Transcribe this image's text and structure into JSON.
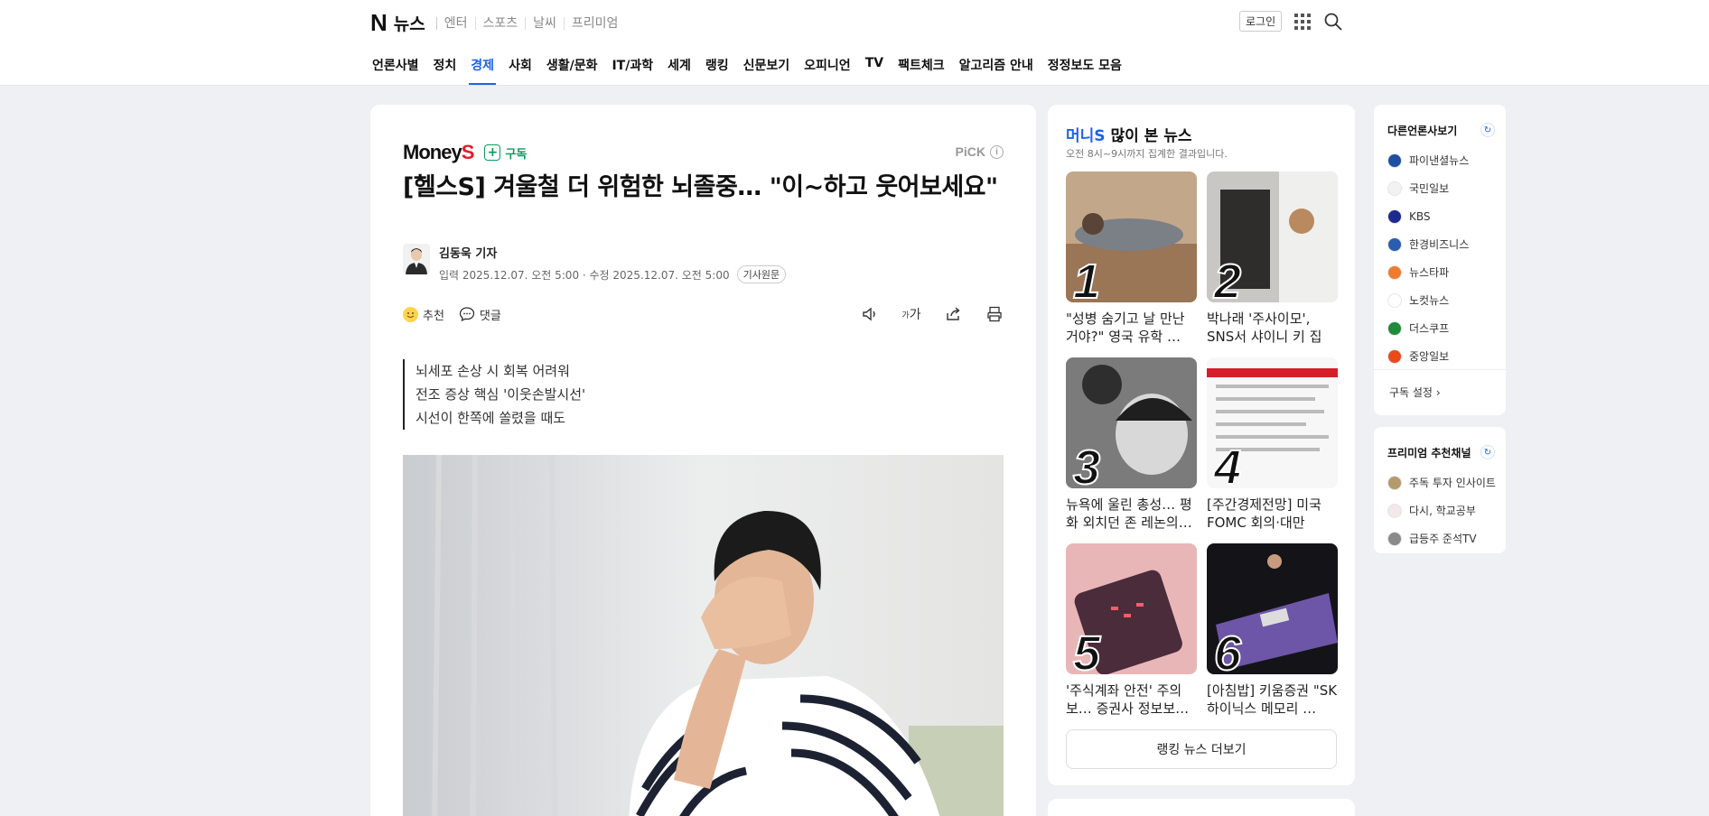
{
  "header": {
    "logo": "N",
    "site_name": "뉴스",
    "services": [
      "엔터",
      "스포츠",
      "날씨",
      "프리미엄"
    ],
    "login_label": "로그인"
  },
  "categories": [
    {
      "label": "언론사별",
      "active": false
    },
    {
      "label": "정치",
      "active": false
    },
    {
      "label": "경제",
      "active": true
    },
    {
      "label": "사회",
      "active": false
    },
    {
      "label": "생활/문화",
      "active": false
    },
    {
      "label": "IT/과학",
      "active": false
    },
    {
      "label": "세계",
      "active": false
    },
    {
      "label": "랭킹",
      "active": false
    },
    {
      "label": "신문보기",
      "active": false
    },
    {
      "label": "오피니언",
      "active": false
    },
    {
      "label": "TV",
      "active": false
    },
    {
      "label": "팩트체크",
      "active": false
    },
    {
      "label": "알고리즘 안내",
      "active": false
    },
    {
      "label": "정정보도 모음",
      "active": false
    }
  ],
  "article": {
    "press_name": "Money",
    "press_name_accent": "S",
    "subscribe_label": "구독",
    "pick_label": "PiCK",
    "pick_info": "i",
    "headline": "[헬스S] 겨울철 더 위험한 뇌졸중… \"이~하고 웃어보세요\"",
    "reporter": "김동욱 기자",
    "dates": "입력 2025.12.07. 오전 5:00 · 수정 2025.12.07. 오전 5:00",
    "original_label": "기사원문",
    "actions": {
      "recommend": "추천",
      "comment": "댓글",
      "font_size": "가"
    },
    "summary": [
      "뇌세포 손상 시 회복 어려워",
      "전조 증상 핵심 '이웃손발시선'",
      "시선이 한쪽에 쏠렸을 때도"
    ]
  },
  "ranking": {
    "press": "머니S",
    "title_rest": "많이 본 뉴스",
    "subtitle": "오전 8시~9시까지 집계한 결과입니다.",
    "items": [
      {
        "rank": "1",
        "title": "\"성병 숨기고 날 만난 거야?\" 영국 유학 …"
      },
      {
        "rank": "2",
        "title": "박나래 '주사이모', SNS서 샤이니 키 집 영…"
      },
      {
        "rank": "3",
        "title": "뉴욕에 울린 총성… 평화 외치던 존 레논의…"
      },
      {
        "rank": "4",
        "title": "[주간경제전망] 미국 FOMC 회의·대만 TS…"
      },
      {
        "rank": "5",
        "title": "'주식계좌 안전' 주의보… 증권사 정보보…"
      },
      {
        "rank": "6",
        "title": "[아침밥] 키움증권 \"SK하이닉스 메모리 …"
      }
    ],
    "more_label": "랭킹 뉴스 더보기"
  },
  "other_press": {
    "title": "다른언론사보기",
    "items": [
      {
        "name": "파이낸셜뉴스",
        "color": "#1f4fa3"
      },
      {
        "name": "국민일보",
        "color": "#f2f2f2"
      },
      {
        "name": "KBS",
        "color": "#1c2a8f"
      },
      {
        "name": "한경비즈니스",
        "color": "#2a5db0"
      },
      {
        "name": "뉴스타파",
        "color": "#f07a2e"
      },
      {
        "name": "노컷뉴스",
        "color": "#ffffff"
      },
      {
        "name": "더스쿠프",
        "color": "#1f8a3a"
      },
      {
        "name": "중앙일보",
        "color": "#e84a1c"
      }
    ],
    "setting_label": "구독 설정"
  },
  "premium": {
    "title": "프리미엄 추천채널",
    "items": [
      {
        "name": "주독 투자 인사이트",
        "color": "#b59a6b"
      },
      {
        "name": "다시, 학교공부",
        "color": "#f4e8e8"
      },
      {
        "name": "급등주 준석TV",
        "color": "#8a8a8a"
      }
    ]
  }
}
